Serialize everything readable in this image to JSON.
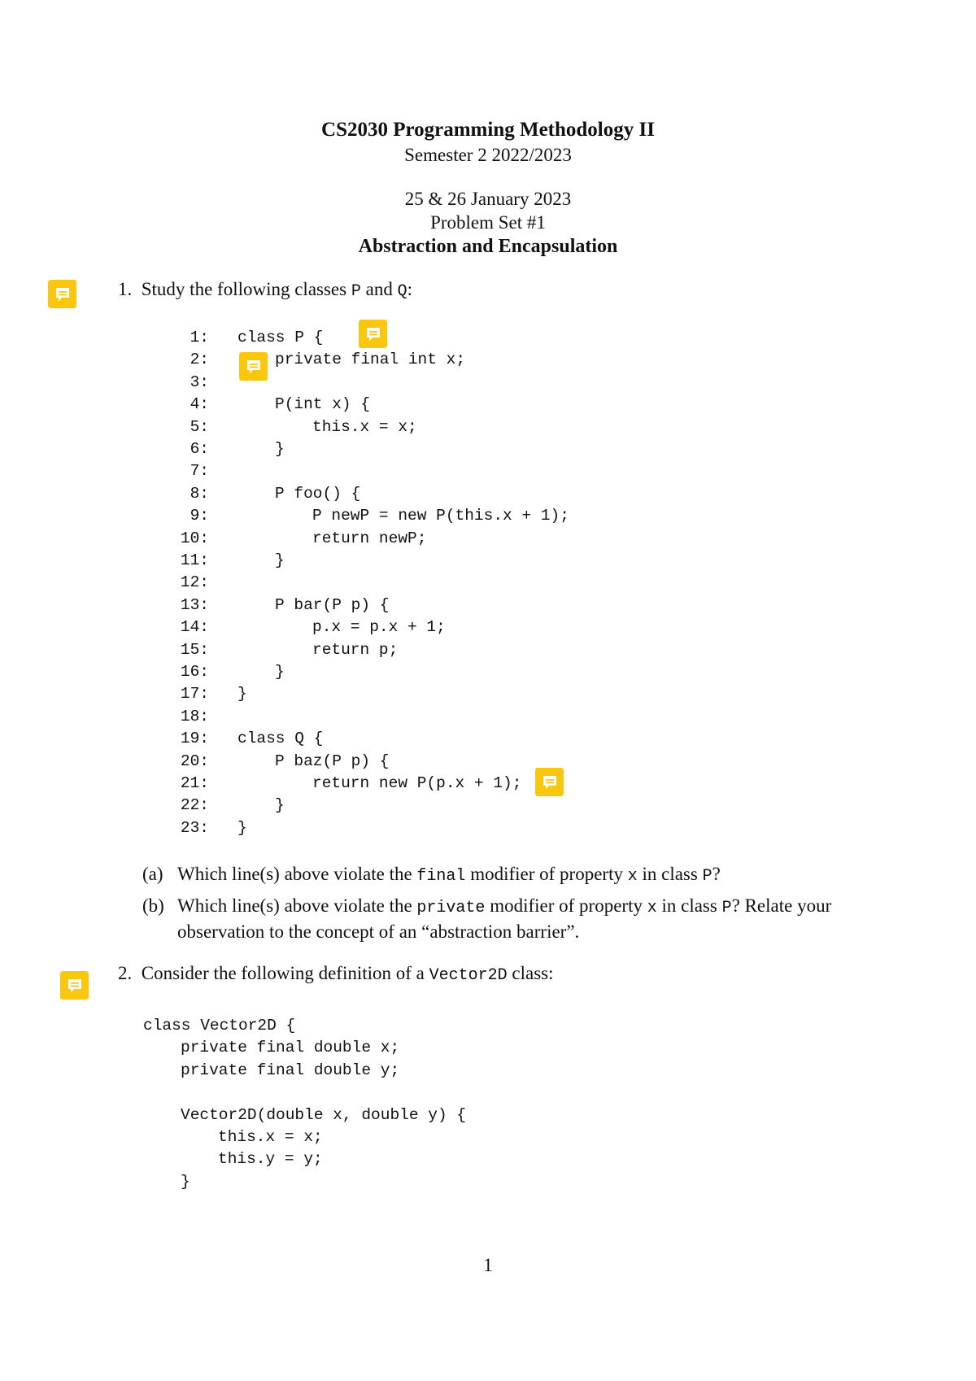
{
  "header": {
    "course_title": "CS2030 Programming Methodology II",
    "semester": "Semester 2 2022/2023",
    "date": "25 & 26 January 2023",
    "problem_set": "Problem Set #1",
    "topic": "Abstraction and Encapsulation"
  },
  "question1": {
    "number": "1.",
    "text_before": "Study the following classes ",
    "class_p": "P",
    "text_and": " and ",
    "class_q": "Q",
    "text_after": ":",
    "code_lines": [
      {
        "no": "1:",
        "indent": 0,
        "code": "class P {"
      },
      {
        "no": "2:",
        "indent": 1,
        "code": "private final int x;"
      },
      {
        "no": "3:",
        "indent": 0,
        "code": ""
      },
      {
        "no": "4:",
        "indent": 1,
        "code": "P(int x) {"
      },
      {
        "no": "5:",
        "indent": 2,
        "code": "this.x = x;"
      },
      {
        "no": "6:",
        "indent": 1,
        "code": "}"
      },
      {
        "no": "7:",
        "indent": 0,
        "code": ""
      },
      {
        "no": "8:",
        "indent": 1,
        "code": "P foo() {"
      },
      {
        "no": "9:",
        "indent": 2,
        "code": "P newP = new P(this.x + 1);"
      },
      {
        "no": "10:",
        "indent": 2,
        "code": "return newP;"
      },
      {
        "no": "11:",
        "indent": 1,
        "code": "}"
      },
      {
        "no": "12:",
        "indent": 0,
        "code": ""
      },
      {
        "no": "13:",
        "indent": 1,
        "code": "P bar(P p) {"
      },
      {
        "no": "14:",
        "indent": 2,
        "code": "p.x = p.x + 1;"
      },
      {
        "no": "15:",
        "indent": 2,
        "code": "return p;"
      },
      {
        "no": "16:",
        "indent": 1,
        "code": "}"
      },
      {
        "no": "17:",
        "indent": 0,
        "code": "}"
      },
      {
        "no": "18:",
        "indent": 0,
        "code": ""
      },
      {
        "no": "19:",
        "indent": 0,
        "code": "class Q {"
      },
      {
        "no": "20:",
        "indent": 1,
        "code": "P baz(P p) {"
      },
      {
        "no": "21:",
        "indent": 2,
        "code": "return new P(p.x + 1);"
      },
      {
        "no": "22:",
        "indent": 1,
        "code": "}"
      },
      {
        "no": "23:",
        "indent": 0,
        "code": "}"
      }
    ],
    "parts": [
      {
        "label": "(a)",
        "t1": "Which line(s) above violate the ",
        "c1": "final",
        "t2": " modifier of property ",
        "c2": "x",
        "t3": " in class ",
        "c3": "P",
        "t4": "?"
      },
      {
        "label": "(b)",
        "t1": "Which line(s) above violate the ",
        "c1": "private",
        "t2": " modifier of property ",
        "c2": "x",
        "t3": " in class ",
        "c3": "P",
        "t4": "? Relate your observation to the concept of an “abstraction barrier”."
      }
    ]
  },
  "question2": {
    "number": "2.",
    "text_before": "Consider the following definition of a ",
    "class_name": "Vector2D",
    "text_after": " class:",
    "code_lines": [
      {
        "indent": 0,
        "code": "class Vector2D {"
      },
      {
        "indent": 1,
        "code": "private final double x;"
      },
      {
        "indent": 1,
        "code": "private final double y;"
      },
      {
        "indent": 0,
        "code": ""
      },
      {
        "indent": 1,
        "code": "Vector2D(double x, double y) {"
      },
      {
        "indent": 2,
        "code": "this.x = x;"
      },
      {
        "indent": 2,
        "code": "this.y = y;"
      },
      {
        "indent": 1,
        "code": "}"
      }
    ]
  },
  "annotations": {
    "icon": "comment-note-icon",
    "color": "#f9c80e"
  },
  "footer": {
    "page_number": "1"
  }
}
